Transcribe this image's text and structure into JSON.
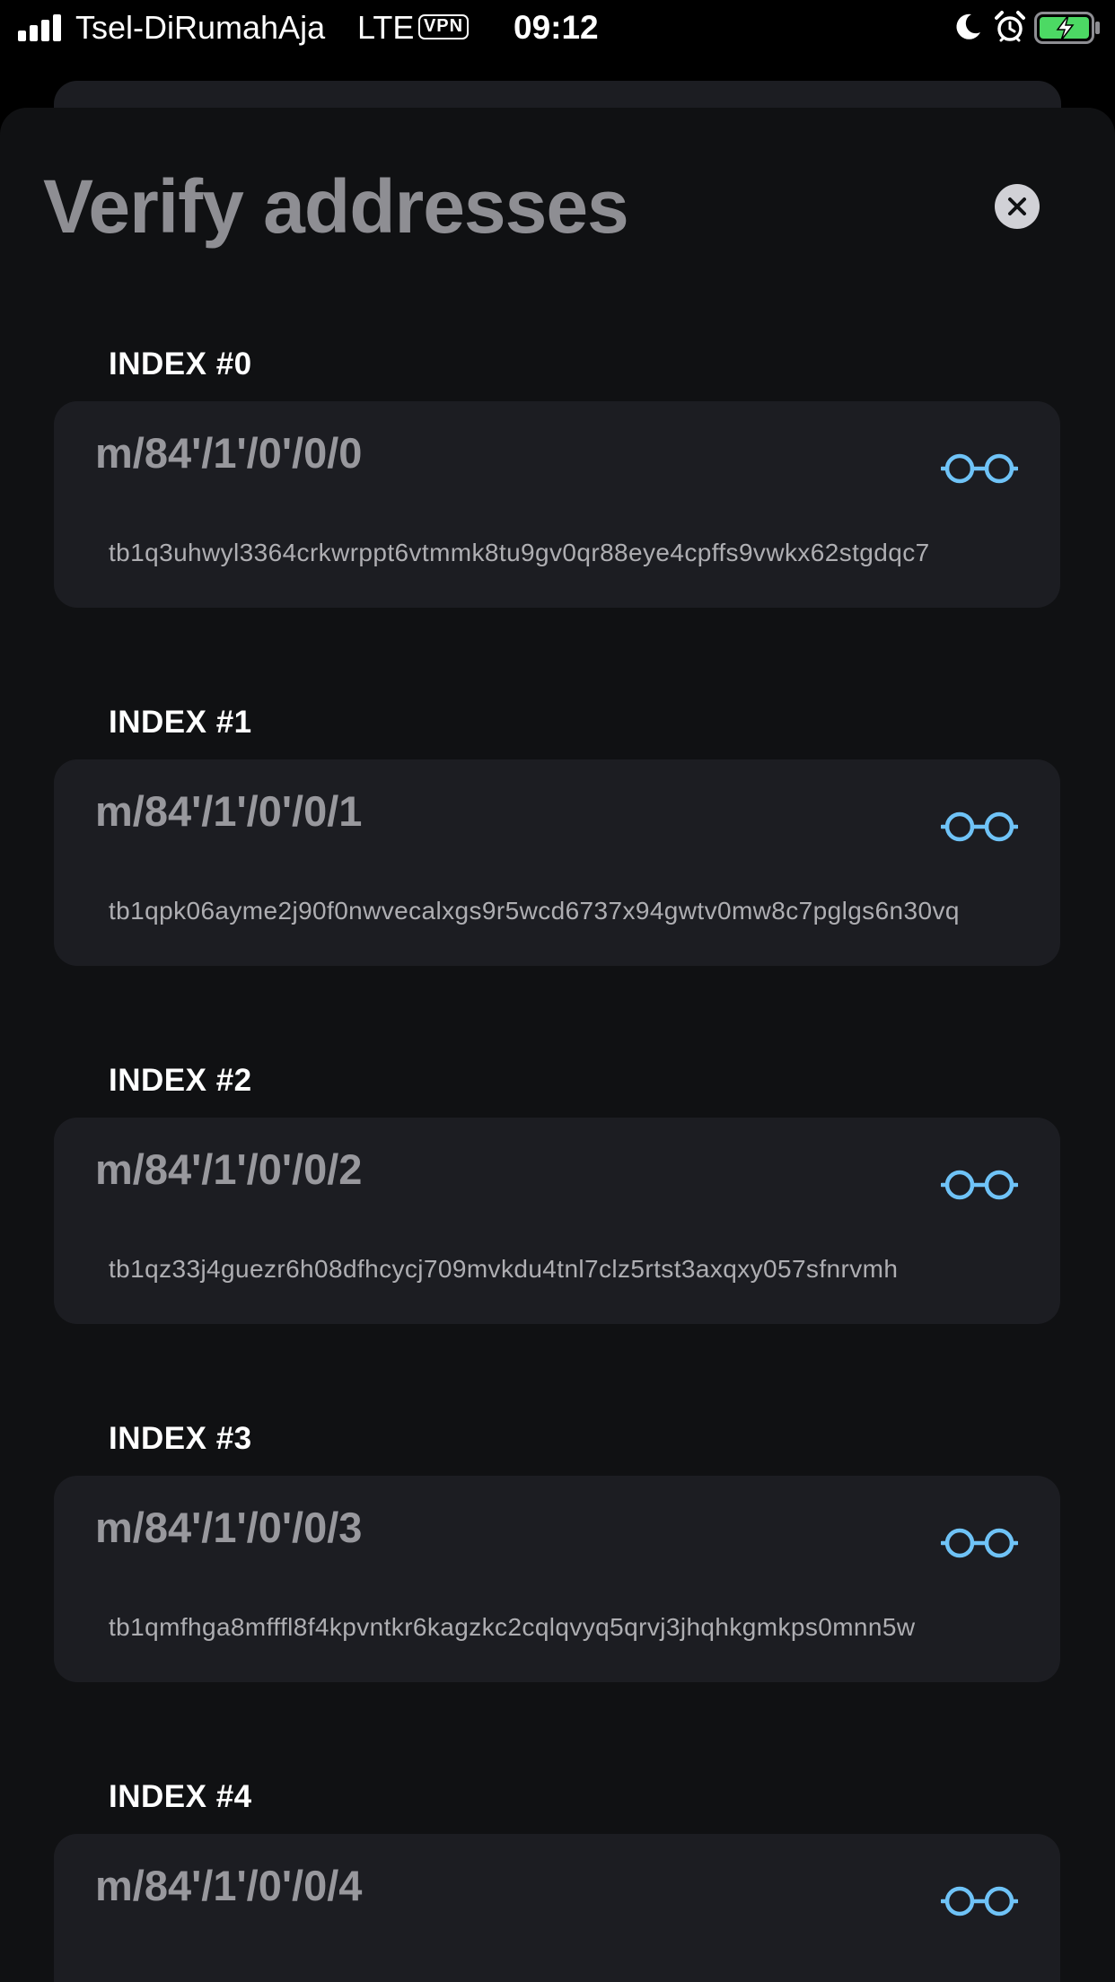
{
  "status_bar": {
    "carrier": "Tsel-DiRumahAja",
    "network": "LTE",
    "vpn": "VPN",
    "time": "09:12",
    "icons": [
      "signal-icon",
      "moon-icon",
      "alarm-icon",
      "battery-charging-icon"
    ],
    "battery_color": "#4cd964"
  },
  "sheet": {
    "title": "Verify addresses",
    "close_icon": "close-icon"
  },
  "accent_color": "#6fc3f7",
  "addresses": [
    {
      "label": "INDEX #0",
      "path": "m/84'/1'/0'/0/0",
      "address": "tb1q3uhwyl3364crkwrppt6vtmmk8tu9gv0qr88eye4cpffs9vwkx62stgdqc7"
    },
    {
      "label": "INDEX #1",
      "path": "m/84'/1'/0'/0/1",
      "address": "tb1qpk06ayme2j90f0nwvecalxgs9r5wcd6737x94gwtv0mw8c7pglgs6n30vq"
    },
    {
      "label": "INDEX #2",
      "path": "m/84'/1'/0'/0/2",
      "address": "tb1qz33j4guezr6h08dfhcycj709mvkdu4tnl7clz5rtst3axqxy057sfnrvmh"
    },
    {
      "label": "INDEX #3",
      "path": "m/84'/1'/0'/0/3",
      "address": "tb1qmfhga8mfffl8f4kpvntkr6kagzkc2cqlqvyq5qrvj3jhqhkgmkps0mnn5w"
    },
    {
      "label": "INDEX #4",
      "path": "m/84'/1'/0'/0/4",
      "address": ""
    }
  ]
}
